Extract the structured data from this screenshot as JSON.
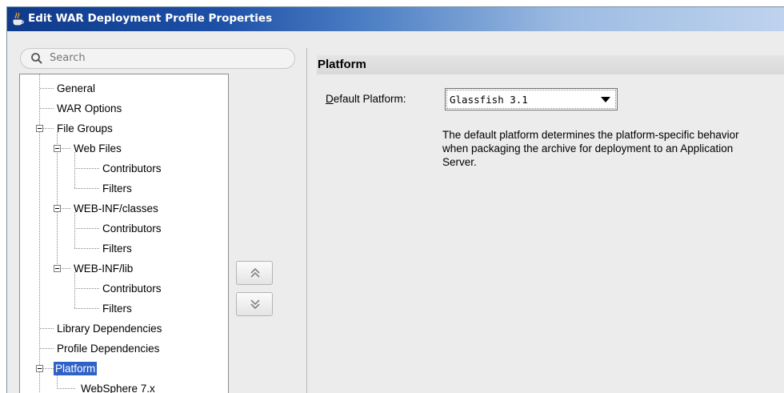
{
  "window": {
    "title": "Edit WAR Deployment Profile Properties"
  },
  "search": {
    "placeholder": "Search"
  },
  "tree": {
    "nodes": [
      {
        "label": "General"
      },
      {
        "label": "WAR Options"
      },
      {
        "label": "File Groups"
      },
      {
        "label": "Web Files"
      },
      {
        "label": "Contributors"
      },
      {
        "label": "Filters"
      },
      {
        "label": "WEB-INF/classes"
      },
      {
        "label": "Contributors"
      },
      {
        "label": "Filters"
      },
      {
        "label": "WEB-INF/lib"
      },
      {
        "label": "Contributors"
      },
      {
        "label": "Filters"
      },
      {
        "label": "Library Dependencies"
      },
      {
        "label": "Profile Dependencies"
      },
      {
        "label": "Platform"
      },
      {
        "label": "WebSphere 7.x"
      }
    ],
    "selected": "Platform"
  },
  "buttons": {
    "move_up": "chevron-double-up-icon",
    "move_down": "chevron-double-down-icon"
  },
  "panel": {
    "title": "Platform",
    "default_platform_label_mnemonic": "D",
    "default_platform_label_rest": "efault Platform:",
    "default_platform_value": "Glassfish 3.1",
    "description_line1": "The default platform determines the platform-specific behavior",
    "description_line2": "when packaging the archive for deployment to an Application",
    "description_line3": "Server."
  },
  "colors": {
    "selection": "#2f62c7",
    "title_bar_start": "#103a8a",
    "title_bar_end": "#bfd3ee"
  }
}
